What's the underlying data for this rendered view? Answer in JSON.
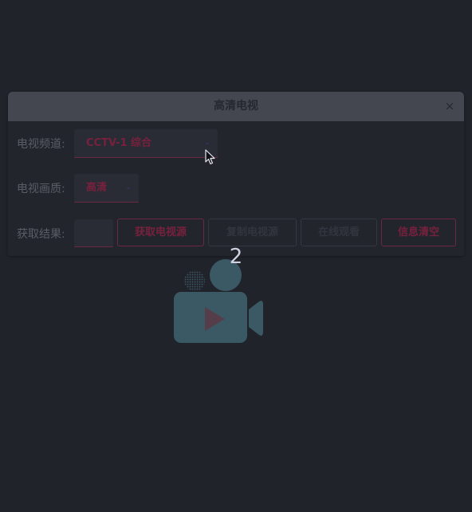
{
  "dialog": {
    "title": "高清电视",
    "close_glyph": "×"
  },
  "form": {
    "channel": {
      "label": "电视频道:",
      "value": "CCTV-1 综合",
      "chevron_glyph": "⌄"
    },
    "quality": {
      "label": "电视画质:",
      "value": "高清",
      "chevron_glyph": "⌄"
    },
    "result": {
      "label": "获取结果:",
      "value": ""
    }
  },
  "buttons": {
    "get_source": "获取电视源",
    "copy_source": "复制电视源",
    "watch_online": "在线观看",
    "clear_info": "信息清空"
  },
  "overlay": {
    "counter": "2",
    "illustration_icon": "video-camera-play-icon"
  },
  "colors": {
    "background": "#21232b",
    "titlebar": "#444750",
    "accent": "#77213d",
    "illustration": "#3b5964"
  }
}
